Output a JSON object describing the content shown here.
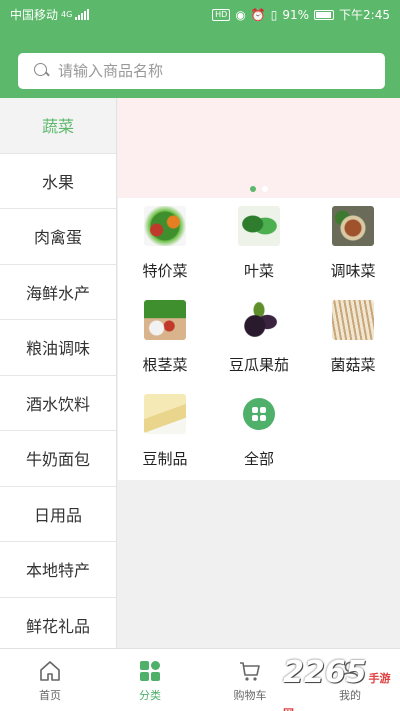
{
  "status": {
    "carrier": "中国移动",
    "net": "4G",
    "hd": "HD",
    "battery": "91%",
    "time": "下午2:45"
  },
  "search": {
    "placeholder": "请输入商品名称"
  },
  "sidebar": {
    "items": [
      {
        "label": "蔬菜",
        "active": true
      },
      {
        "label": "水果"
      },
      {
        "label": "肉禽蛋"
      },
      {
        "label": "海鲜水产"
      },
      {
        "label": "粮油调味"
      },
      {
        "label": "酒水饮料"
      },
      {
        "label": "牛奶面包"
      },
      {
        "label": "日用品"
      },
      {
        "label": "本地特产"
      },
      {
        "label": "鲜花礼品"
      }
    ]
  },
  "banner": {
    "active_dot": 0
  },
  "grid": {
    "items": [
      {
        "label": "特价菜",
        "icon": "mixed-vegetables-image"
      },
      {
        "label": "叶菜",
        "icon": "leafy-greens-image"
      },
      {
        "label": "调味菜",
        "icon": "seasoning-vegetables-image"
      },
      {
        "label": "根茎菜",
        "icon": "root-vegetables-image"
      },
      {
        "label": "豆瓜果茄",
        "icon": "eggplant-image"
      },
      {
        "label": "菌菇菜",
        "icon": "mushroom-image"
      },
      {
        "label": "豆制品",
        "icon": "tofu-image"
      },
      {
        "label": "全部",
        "icon": "all-grid-icon"
      }
    ]
  },
  "tabbar": {
    "items": [
      {
        "label": "首页",
        "icon": "home-icon"
      },
      {
        "label": "分类",
        "icon": "category-icon",
        "active": true
      },
      {
        "label": "购物车",
        "icon": "cart-icon"
      },
      {
        "label": "我的",
        "icon": "user-icon"
      }
    ]
  },
  "watermark": {
    "main": "2265",
    "sub": "手游网"
  },
  "colors": {
    "accent": "#5cb86b",
    "banner_bg": "#fdeff0"
  }
}
